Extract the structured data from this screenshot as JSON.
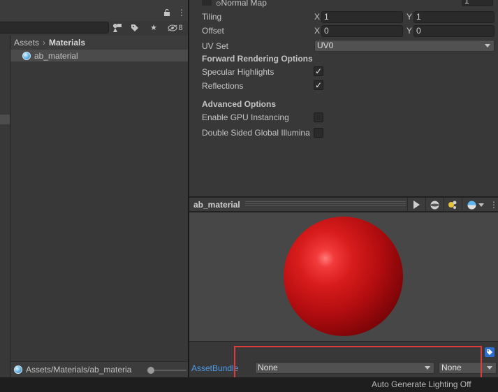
{
  "project": {
    "filter_count": "8",
    "breadcrumb": [
      "Assets",
      "Materials"
    ],
    "asset_name": "ab_material",
    "bottom_path": "Assets/Materials/ab_materia"
  },
  "inspector": {
    "normal_map_label": "Normal Map",
    "normal_map_value": "1",
    "tiling": {
      "label": "Tiling",
      "x_axis": "X",
      "x": "1",
      "y_axis": "Y",
      "y": "1"
    },
    "offset": {
      "label": "Offset",
      "x_axis": "X",
      "x": "0",
      "y_axis": "Y",
      "y": "0"
    },
    "uv_set": {
      "label": "UV Set",
      "value": "UV0"
    },
    "forward_rendering_header": "Forward Rendering Options",
    "specular_highlights": {
      "label": "Specular Highlights",
      "checked": true
    },
    "reflections": {
      "label": "Reflections",
      "checked": true
    },
    "advanced_header": "Advanced Options",
    "gpu_instancing": {
      "label": "Enable GPU Instancing",
      "checked": false
    },
    "double_sided_gi": {
      "label": "Double Sided Global Illumina",
      "checked": false
    }
  },
  "preview": {
    "title": "ab_material",
    "sphere_color": "#d81c1c"
  },
  "asset_bundle": {
    "label": "AssetBundle",
    "bundle_value": "None",
    "variant_value": "None",
    "highlight_color": "#e03a3a"
  },
  "status_bar": {
    "text": "Auto Generate Lighting Off"
  }
}
